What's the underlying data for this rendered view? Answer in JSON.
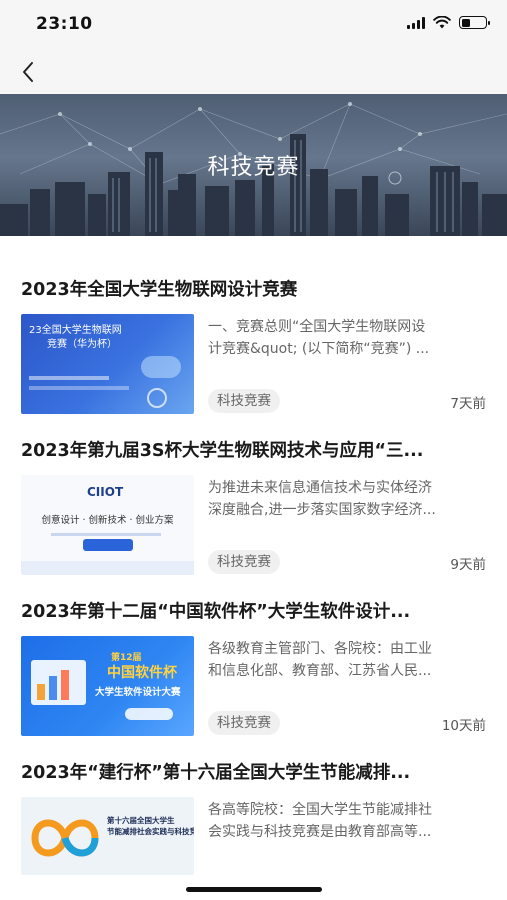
{
  "status_bar": {
    "time": "23:10"
  },
  "nav": {
    "back_icon": "chevron-left-icon"
  },
  "banner": {
    "title": "科技竞赛"
  },
  "articles": [
    {
      "title": "2023年全国大学生物联网设计竞赛",
      "summary_lines": [
        "一、竞赛总则“全国大学生物联网设",
        "计竞赛&quot; (以下简称“竞赛”) ..."
      ],
      "tag": "科技竞赛",
      "time": "7天前",
      "thumb_text": [
        "23全国大学生物联网",
        "竞赛（华为杯）"
      ]
    },
    {
      "title": "2023年第九届3S杯大学生物联网技术与应用“三...",
      "summary_lines": [
        "为推进未来信息通信技术与实体经济",
        "深度融合,进一步落实国家数字经济..."
      ],
      "tag": "科技竞赛",
      "time": "9天前",
      "thumb_text": [
        "CIIOT",
        "创意设计 · 创新技术 · 创业方案"
      ]
    },
    {
      "title": "2023年第十二届“中国软件杯”大学生软件设计...",
      "summary_lines": [
        "各级教育主管部门、各院校：由工业",
        "和信息化部、教育部、江苏省人民..."
      ],
      "tag": "科技竞赛",
      "time": "10天前",
      "thumb_text": [
        "第12届",
        "中国软件杯",
        "大学生软件设计大赛"
      ]
    },
    {
      "title": "2023年“建行杯”第十六届全国大学生节能减排...",
      "summary_lines": [
        "各高等院校：全国大学生节能减排社",
        "会实践与科技竞赛是由教育部高等..."
      ],
      "tag": "",
      "time": "",
      "thumb_text": [
        "第十六届全国大学生",
        "节能减排社会实践与科技竞赛"
      ]
    }
  ]
}
